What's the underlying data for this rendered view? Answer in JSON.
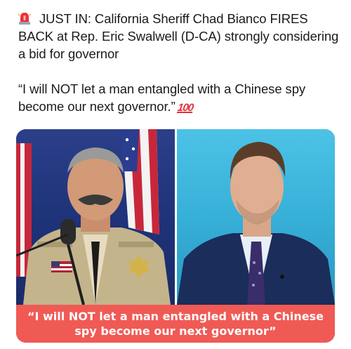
{
  "post": {
    "siren_icon": "police-car-light-icon",
    "headline": "JUST IN: California Sheriff Chad Bianco FIRES BACK at Rep. Eric Swalwell (D-CA) strongly considering a bid for governor",
    "quote": "“I will NOT let a man entangled with a Chinese spy become our next governor.”",
    "hundred_icon": "100"
  },
  "media": {
    "left_photo": "sheriff-at-podium-photo",
    "right_photo": "congressman-portrait-photo",
    "caption": "“I will NOT let a man entangled with a Chinese spy become our next governor”",
    "caption_color": "#f05a55"
  }
}
